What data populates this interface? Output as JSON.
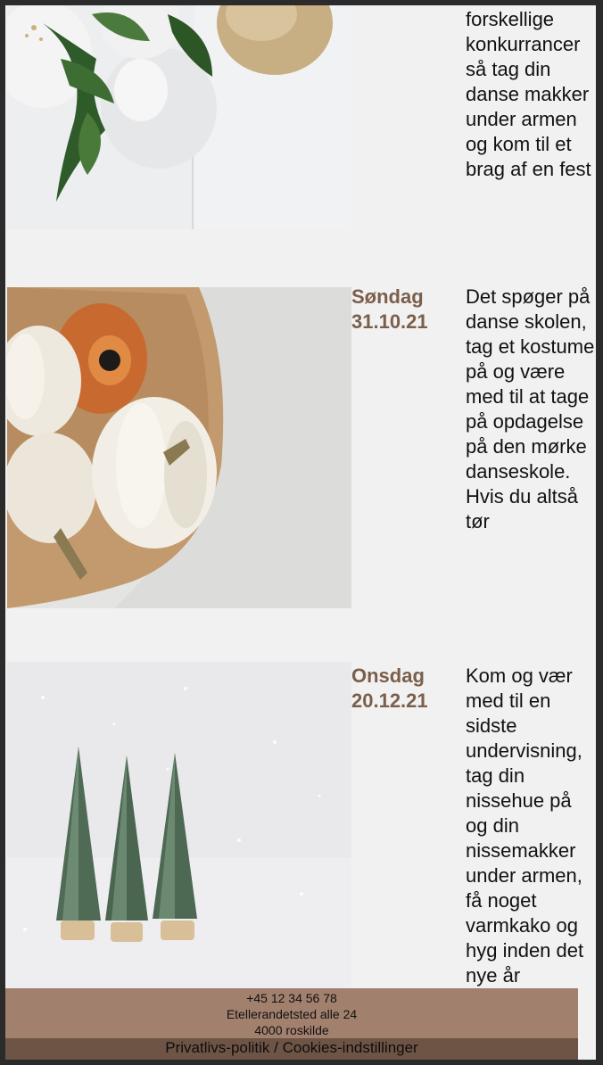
{
  "events": [
    {
      "date_day": "",
      "date_num": "",
      "text": "forskellige konkurrancer så tag din danse makker under armen og kom til et brag af en fest"
    },
    {
      "date_day": "Søndag",
      "date_num": "31.10.21",
      "text": "Det spøger på danse skolen, tag et kostume på og være med til at tage på opdagelse på den mørke danseskole. Hvis du altså tør"
    },
    {
      "date_day": "Onsdag",
      "date_num": "20.12.21",
      "text": "Kom og vær med til en sidste undervisning, tag din nissehue på og din nissemakker under armen, få noget varmkako og hyg inden det nye år"
    }
  ],
  "footer": {
    "phone": "+45 12 34 56 78",
    "address": "Etellerandetsted alle 24",
    "city": "4000 roskilde",
    "privacy": "Privatlivs-politik",
    "separator": " / ",
    "cookies": "Cookies-indstillinger"
  },
  "colors": {
    "page_bg": "#f2f1f1",
    "date_color": "#7a5f4b",
    "footer_bg": "#a2806e",
    "footer_links_bg": "#6e5445"
  }
}
